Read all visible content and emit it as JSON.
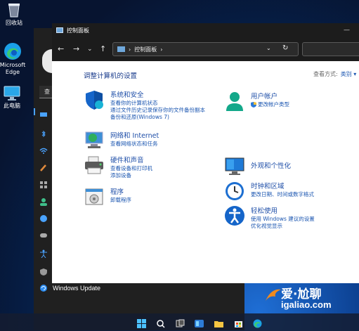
{
  "desktop": {
    "recycle_bin_label": "回收站",
    "edge_label": "Microsoft Edge",
    "this_pc_label": "此电脑"
  },
  "settings_bg": {
    "search_fragment": "查",
    "windows_update_label": "Windows Update"
  },
  "control_panel": {
    "window_title": "控制面板",
    "address_path": "控制面板",
    "heading": "调整计算机的设置",
    "view_by_label": "查看方式:",
    "view_by_value": "类别 ▾",
    "categories": [
      {
        "title": "系统和安全",
        "links": [
          "查看你的计算机状态",
          "通过文件历史记录保存你的文件备份副本",
          "备份和还原(Windows 7)"
        ]
      },
      {
        "title": "网络和 Internet",
        "links": [
          "查看网络状态和任务"
        ]
      },
      {
        "title": "硬件和声音",
        "links": [
          "查看设备和打印机",
          "添加设备"
        ]
      },
      {
        "title": "程序",
        "links": [
          "卸载程序"
        ]
      },
      {
        "title": "用户帐户",
        "links": [
          "更改帐户类型"
        ]
      },
      {
        "title": "外观和个性化",
        "links": []
      },
      {
        "title": "时钟和区域",
        "links": [
          "更改日期、时间或数字格式"
        ]
      },
      {
        "title": "轻松使用",
        "links": [
          "使用 Windows 建议的设置",
          "优化视觉显示"
        ]
      }
    ]
  },
  "watermark": {
    "text": "爱·尬聊",
    "url": "igaliao.com"
  },
  "colors": {
    "link": "#1a55b0",
    "titlebar": "#1c1c1c",
    "accent": "#0a67c9"
  }
}
